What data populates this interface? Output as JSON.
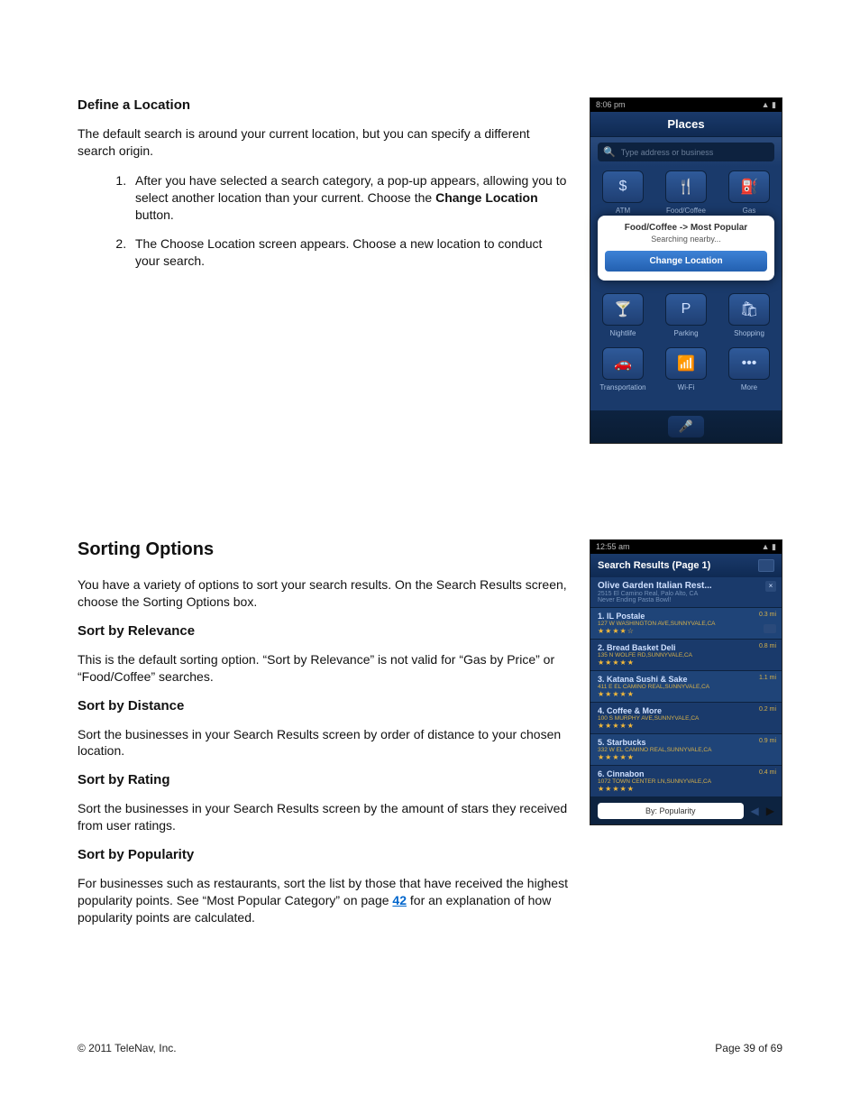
{
  "section1": {
    "title": "Define a Location",
    "intro": "The default search is around your current location, but you can specify a different search origin.",
    "step1_a": "After you have selected a search category, a pop-up appears, allowing you to select another location than your current. Choose the ",
    "step1_bold": "Change Location",
    "step1_b": " button.",
    "step2": "The Choose Location screen appears. Choose a new location to conduct your search."
  },
  "section2": {
    "title": "Sorting Options",
    "intro": "You have a variety of options to sort your search results. On the Search Results screen, choose the Sorting Options box.",
    "relevance_h": "Sort by Relevance",
    "relevance_p": "This is the default sorting option. “Sort by Relevance” is not valid for “Gas by Price” or “Food/Coffee” searches.",
    "distance_h": "Sort by Distance",
    "distance_p": "Sort the businesses in your Search Results screen by order of distance to your chosen location.",
    "rating_h": "Sort by Rating",
    "rating_p": "Sort the businesses in your Search Results screen by the amount of stars they received from user ratings.",
    "popularity_h": "Sort by Popularity",
    "popularity_p_a": "For businesses such as restaurants, sort the list by those that have received the highest popularity points. See “Most Popular Category” on page ",
    "popularity_link": "42",
    "popularity_p_b": " for an explanation of how popularity points are calculated."
  },
  "shot1": {
    "time": "8:06 pm",
    "title": "Places",
    "placeholder": "Type address or business",
    "cats": {
      "atm": "ATM",
      "food": "Food/Coffee",
      "gas": "Gas",
      "nightlife": "Nightlife",
      "parking": "Parking",
      "shopping": "Shopping",
      "transport": "Transportation",
      "wifi": "Wi-Fi",
      "more": "More"
    },
    "popup_l1": "Food/Coffee -> Most Popular",
    "popup_l2": "Searching nearby...",
    "popup_btn": "Change Location"
  },
  "shot2": {
    "time": "12:55 am",
    "title": "Search Results (Page 1)",
    "sponsor_name": "Olive Garden Italian Rest...",
    "sponsor_addr": "2515 El Camino Real, Palo Alto, CA",
    "sponsor_tag": "Never Ending Pasta Bowl!",
    "sort_label": "By:  Popularity",
    "results": [
      {
        "n": "1. IL Postale",
        "a": "127 W WASHINGTON AVE,SUNNYVALE,CA",
        "d": "0.3 mi",
        "s": 4
      },
      {
        "n": "2. Bread Basket Deli",
        "a": "135 N WOLFE RD,SUNNYVALE,CA",
        "d": "0.8 mi",
        "s": 5
      },
      {
        "n": "3. Katana Sushi & Sake",
        "a": "411 E EL CAMINO REAL,SUNNYVALE,CA",
        "d": "1.1 mi",
        "s": 5
      },
      {
        "n": "4. Coffee & More",
        "a": "100 S MURPHY AVE,SUNNYVALE,CA",
        "d": "0.2 mi",
        "s": 5
      },
      {
        "n": "5. Starbucks",
        "a": "332 W EL CAMINO REAL,SUNNYVALE,CA",
        "d": "0.9 mi",
        "s": 5
      },
      {
        "n": "6. Cinnabon",
        "a": "1072 TOWN CENTER LN,SUNNYVALE,CA",
        "d": "0.4 mi",
        "s": 5
      }
    ]
  },
  "footer": {
    "copyright": "© 2011 TeleNav, Inc.",
    "page": "Page 39 of 69"
  }
}
